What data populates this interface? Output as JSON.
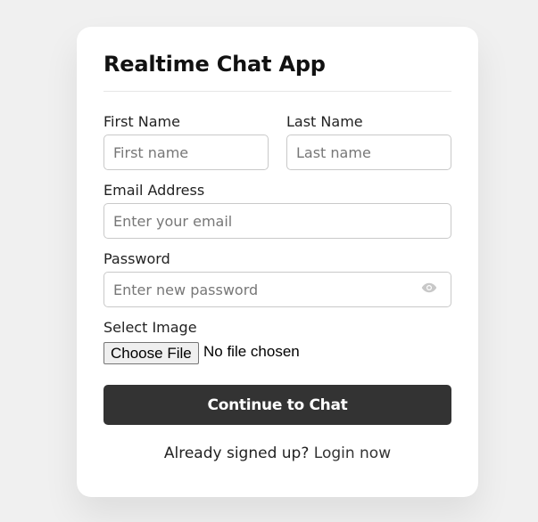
{
  "form": {
    "title": "Realtime Chat App",
    "first_name": {
      "label": "First Name",
      "placeholder": "First name",
      "value": ""
    },
    "last_name": {
      "label": "Last Name",
      "placeholder": "Last name",
      "value": ""
    },
    "email": {
      "label": "Email Address",
      "placeholder": "Enter your email",
      "value": ""
    },
    "password": {
      "label": "Password",
      "placeholder": "Enter new password",
      "value": "",
      "toggle_icon": "eye-icon"
    },
    "image": {
      "label": "Select Image",
      "button_label": "Choose File",
      "status": "No file chosen"
    },
    "submit_label": "Continue to Chat",
    "footer": {
      "prompt": "Already signed up?",
      "link": "Login now"
    }
  },
  "colors": {
    "page_background": "#f0f0f0",
    "card_background": "#ffffff",
    "button_background": "#333333",
    "button_text": "#ffffff",
    "input_border": "#c9c9c9"
  }
}
